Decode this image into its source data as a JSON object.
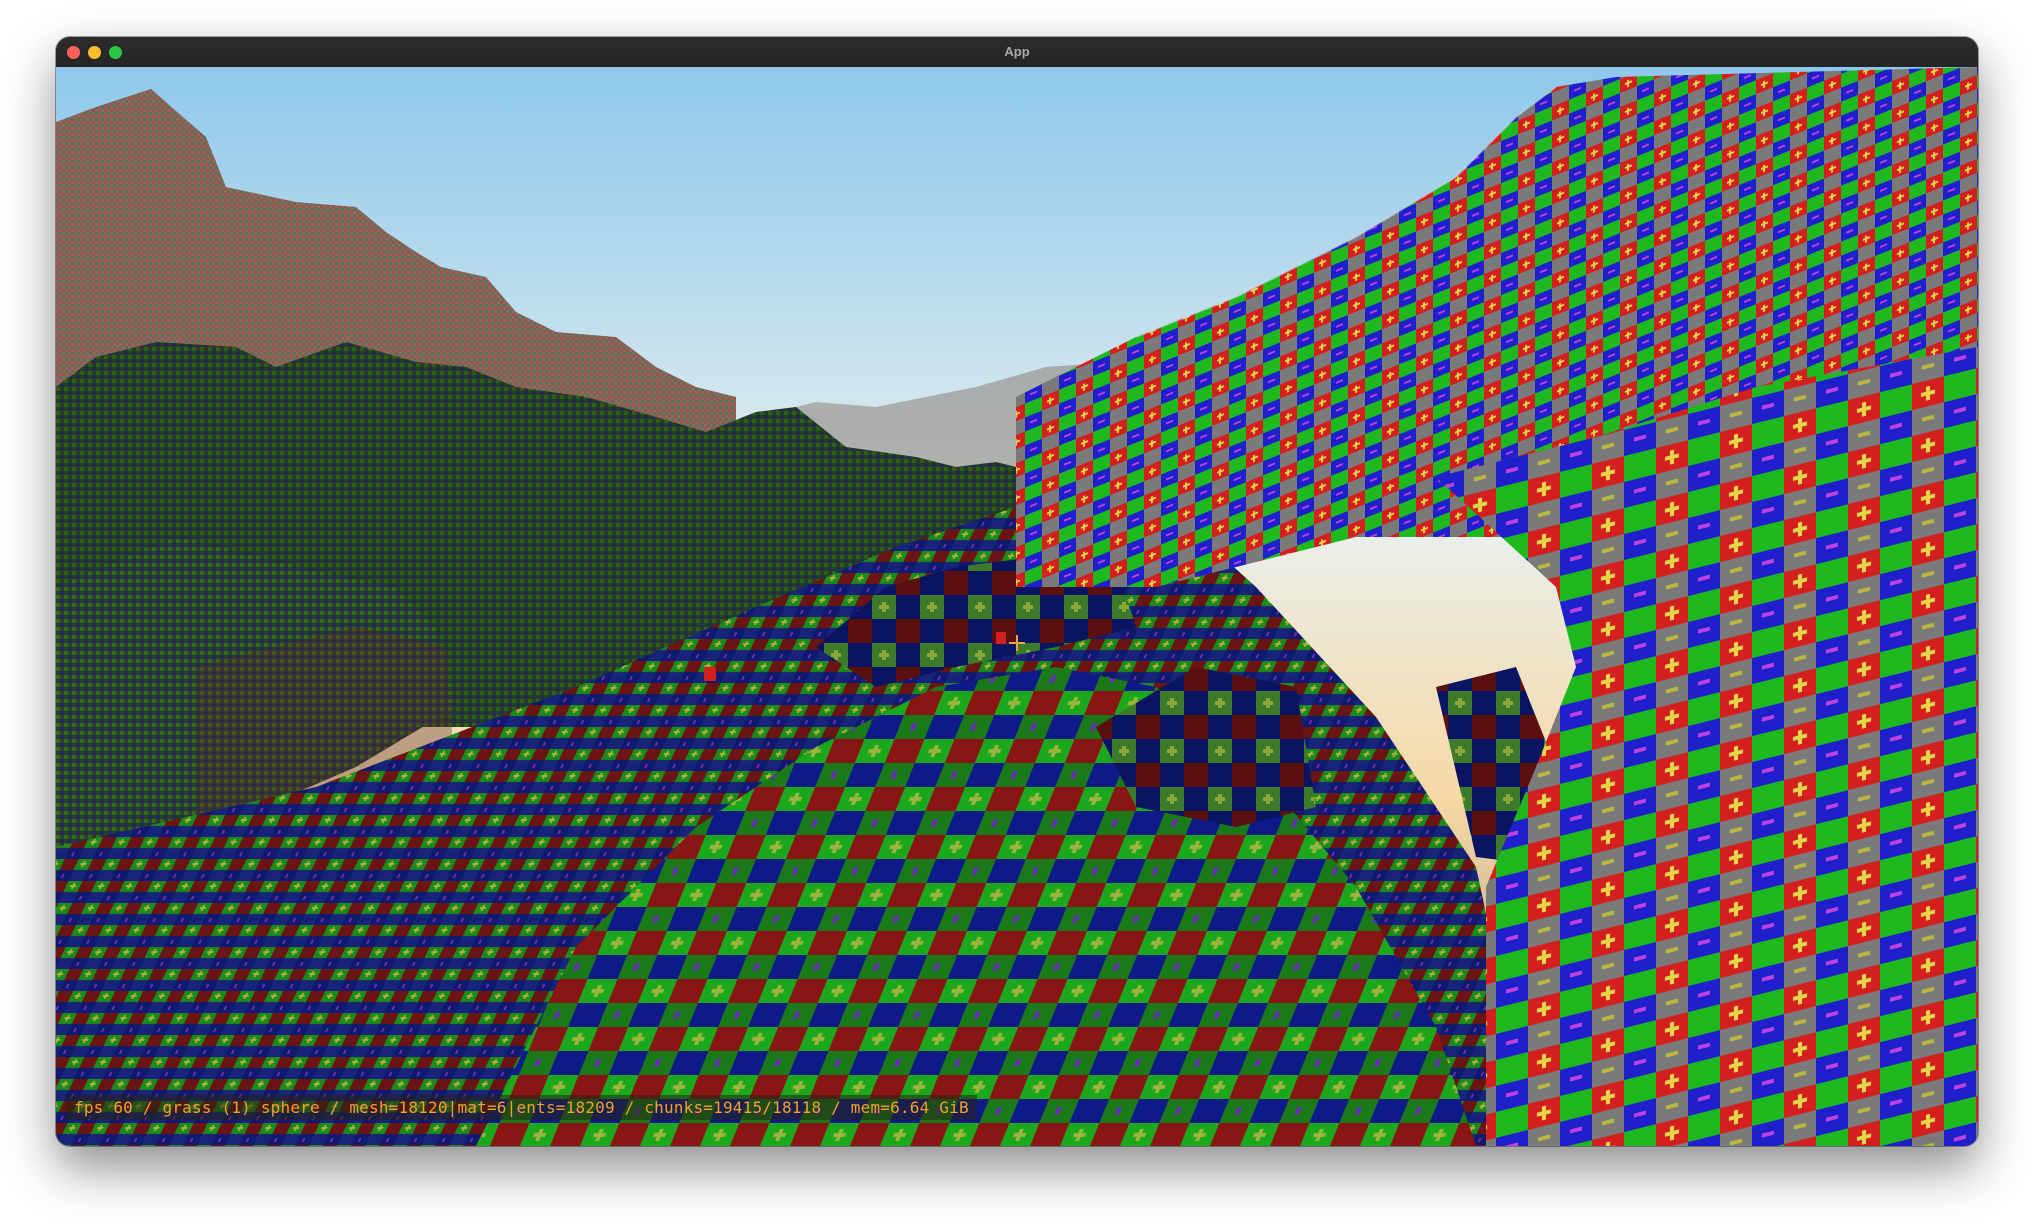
{
  "window": {
    "title": "App"
  },
  "hud": {
    "stats_text": "fps 60 / grass (1) sphere / mesh=18120|mat=6|ents=18209 / chunks=19415/18118 / mem=6.64 GiB"
  },
  "scene": {
    "sky_colors": [
      "#8ec8ec",
      "#e9f0ee",
      "#f6d8a4",
      "#9f8f84"
    ],
    "block_colors": [
      "#d41f1f",
      "#1fb81f",
      "#1f1fcc",
      "#7a7a7a"
    ],
    "glyph_colors": [
      "#c9c73a",
      "#b23ad2"
    ]
  }
}
